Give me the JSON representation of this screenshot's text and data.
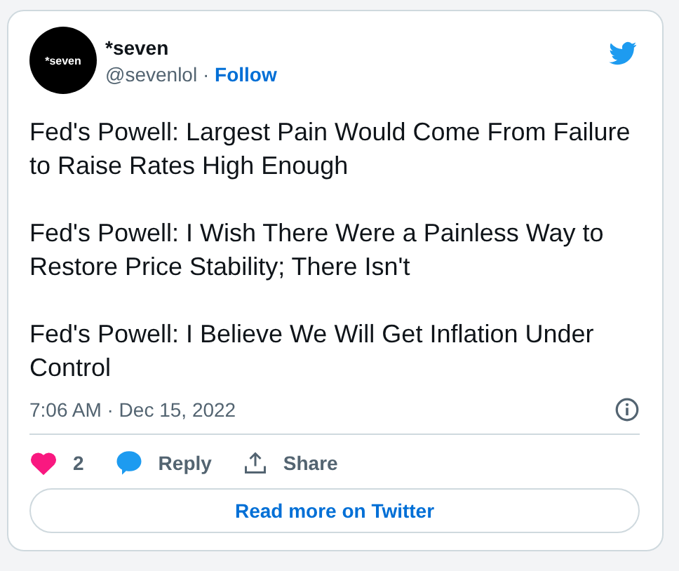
{
  "author": {
    "avatar_text": "*seven",
    "name": "*seven",
    "handle": "@sevenlol ·",
    "follow": "Follow"
  },
  "paragraphs": [
    "Fed's Powell: Largest Pain Would Come From Failure to Raise Rates High Enough",
    "Fed's Powell: I Wish There Were a Painless Way to Restore Price Stability; There Isn't",
    "Fed's Powell: I Believe We Will Get Inflation Under Control"
  ],
  "timestamp": "7:06 AM · Dec 15, 2022",
  "actions": [
    {
      "kind": "like",
      "label": "2"
    },
    {
      "kind": "reply",
      "label": "Reply"
    },
    {
      "kind": "share",
      "label": "Share"
    }
  ],
  "read_more": "Read more on Twitter"
}
